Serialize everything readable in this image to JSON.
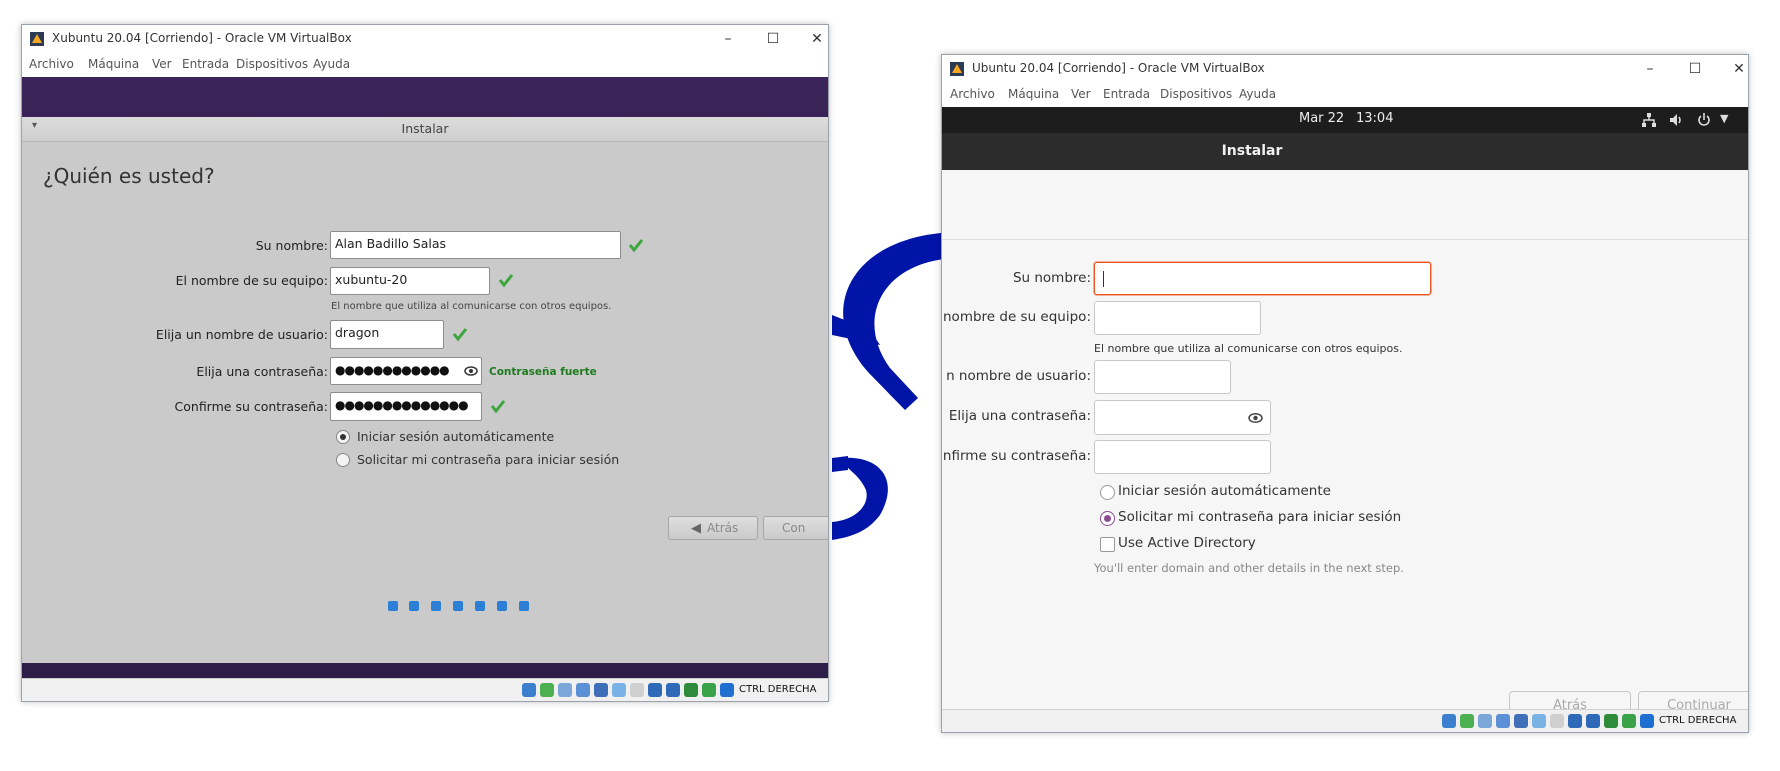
{
  "left_window": {
    "title": "Xubuntu 20.04 [Corriendo] - Oracle VM VirtualBox",
    "menu": [
      "Archivo",
      "Máquina",
      "Ver",
      "Entrada",
      "Dispositivos",
      "Ayuda"
    ],
    "dialog_title": "Instalar",
    "heading": "¿Quién es usted?",
    "fields": {
      "name_label": "Su nombre:",
      "name_value": "Alan Badillo Salas",
      "computer_label": "El nombre de su equipo:",
      "computer_value": "xubuntu-20",
      "computer_hint": "El nombre que utiliza al comunicarse con otros equipos.",
      "username_label": "Elija un nombre de usuario:",
      "username_value": "dragon",
      "password_label": "Elija una contraseña:",
      "password_mask": "●●●●●●●●●●●●",
      "password_strength": "Contraseña fuerte",
      "confirm_label": "Confirme su contraseña:",
      "confirm_mask": "●●●●●●●●●●●●●●"
    },
    "radio_auto": "Iniciar sesión automáticamente",
    "radio_ask": "Solicitar mi contraseña para iniciar sesión",
    "selected_radio": "auto",
    "back_button": "Atrás",
    "continue_button": "Con",
    "progress_total": 7,
    "status_text": "CTRL DERECHA",
    "accent_color": "#2c7fd6"
  },
  "right_window": {
    "title": "Ubuntu 20.04 [Corriendo] - Oracle VM VirtualBox",
    "menu": [
      "Archivo",
      "Máquina",
      "Ver",
      "Entrada",
      "Dispositivos",
      "Ayuda"
    ],
    "topbar_date": "Mar 22",
    "topbar_time": "13:04",
    "header_title": "Instalar",
    "fields": {
      "name_label": "Su nombre:",
      "computer_label": "nombre de su equipo:",
      "computer_hint": "El nombre que utiliza al comunicarse con otros equipos.",
      "username_label": "n nombre de usuario:",
      "password_label": "Elija una contraseña:",
      "confirm_label": "nfirme su contraseña:"
    },
    "radio_auto": "Iniciar sesión automáticamente",
    "radio_ask": "Solicitar mi contraseña para iniciar sesión",
    "selected_radio": "ask",
    "ad_checkbox": "Use Active Directory",
    "ad_hint": "You'll enter domain and other details in the next step.",
    "back_button": "Atrás",
    "continue_button": "Continuar",
    "status_text": "CTRL DERECHA",
    "accent_color": "#8a4c8f",
    "focus_color": "#e95420"
  },
  "background": {
    "decor_color": "#0014a8"
  }
}
